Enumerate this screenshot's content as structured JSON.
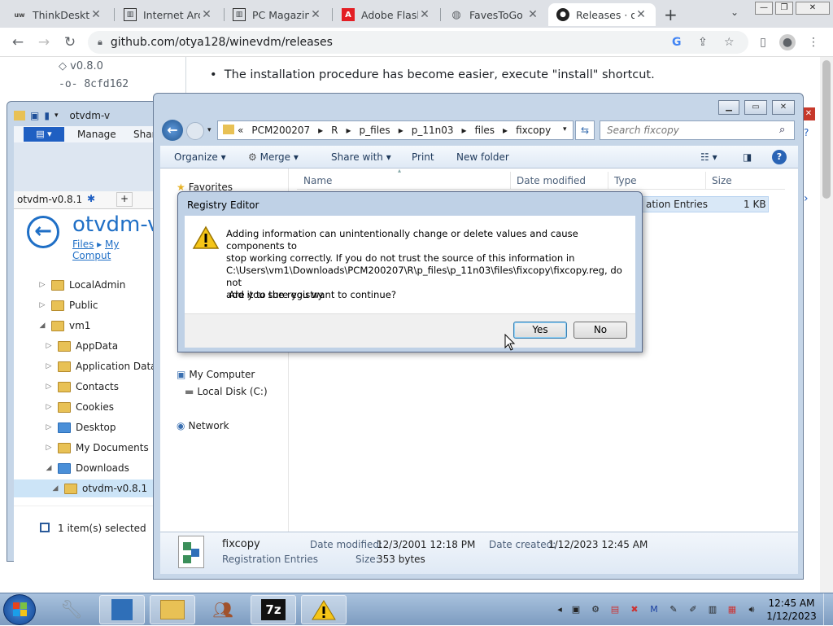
{
  "browser": {
    "tabs": [
      {
        "label": "ThinkDesktop",
        "icon": "uw"
      },
      {
        "label": "Internet Arch"
      },
      {
        "label": "PC Magazine"
      },
      {
        "label": "Adobe Flash"
      },
      {
        "label": "FavesToGo"
      },
      {
        "label": "Releases · ot"
      }
    ],
    "new_tab": "+",
    "url": "github.com/otya128/winevdm/releases"
  },
  "github": {
    "tag": "v0.8.0",
    "commit": "8cfd162",
    "bullet": "The installation procedure has become easier, execute \"install\" shortcut."
  },
  "back_explorer": {
    "title": "otvdm-v",
    "ribbon": {
      "manage": "Manage",
      "share": "Share"
    },
    "tab_label": "otvdm-v0.8.1",
    "heading": "otvdm-v",
    "breadcrumb": [
      "Files",
      "My Comput"
    ],
    "tree": [
      {
        "label": "LocalAdmin",
        "indent": 0
      },
      {
        "label": "Public",
        "indent": 0
      },
      {
        "label": "vm1",
        "indent": 0
      },
      {
        "label": "AppData",
        "indent": 1
      },
      {
        "label": "Application Data",
        "indent": 1
      },
      {
        "label": "Contacts",
        "indent": 1
      },
      {
        "label": "Cookies",
        "indent": 1
      },
      {
        "label": "Desktop",
        "indent": 1
      },
      {
        "label": "My Documents",
        "indent": 1
      },
      {
        "label": "Downloads",
        "indent": 1
      },
      {
        "label": "otvdm-v0.8.1",
        "indent": 2
      }
    ],
    "status": "1 item(s) selected"
  },
  "explorer": {
    "path": [
      "«",
      "PCM200207",
      "R",
      "p_files",
      "p_11n03",
      "files",
      "fixcopy"
    ],
    "search_placeholder": "Search fixcopy",
    "commands": [
      "Organize",
      "Merge",
      "Share with",
      "Print",
      "New folder"
    ],
    "columns": [
      "Name",
      "Date modified",
      "Type",
      "Size"
    ],
    "row": {
      "type": "ation Entries",
      "size": "1 KB"
    },
    "nav": {
      "favorites": "Favorites",
      "computer": "My Computer",
      "disk": "Local Disk (C:)",
      "network": "Network"
    },
    "details": {
      "name": "fixcopy",
      "type": "Registration Entries",
      "modified_label": "Date modified:",
      "modified": "12/3/2001 12:18 PM",
      "created_label": "Date created:",
      "created": "1/12/2023 12:45 AM",
      "size_label": "Size:",
      "size": "353 bytes"
    }
  },
  "dialog": {
    "title": "Registry Editor",
    "message_l1": "Adding information can unintentionally change or delete values and cause components to",
    "message_l2": "stop working correctly. If you do not trust the source of this information in",
    "message_l3": "C:\\Users\\vm1\\Downloads\\PCM200207\\R\\p_files\\p_11n03\\files\\fixcopy\\fixcopy.reg, do not",
    "message_l4": "add it to the registry.",
    "question": "Are you sure you want to continue?",
    "yes": "Yes",
    "no": "No"
  },
  "taskbar": {
    "time": "12:45 AM",
    "date": "1/12/2023"
  }
}
